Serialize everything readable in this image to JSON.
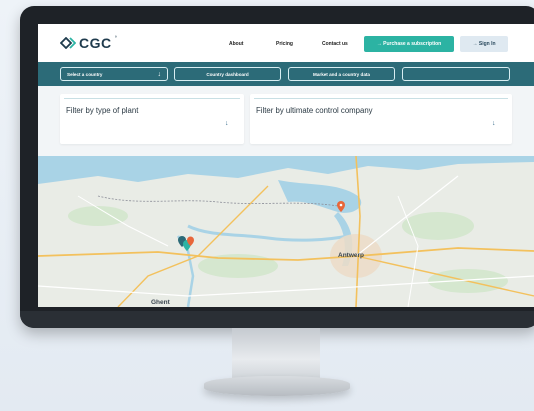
{
  "header": {
    "logo_text": "CGC",
    "logo_mark": "°",
    "nav": {
      "about": "About",
      "pricing": "Pricing",
      "contact": "Contact us"
    },
    "purchase_label": "→ Purchase a subscription",
    "signin_label": "→ Sign In"
  },
  "toolbar": {
    "select_country": "Select a country",
    "select_arrow": "↓",
    "country_dashboard": "Country dashboard",
    "market_data": "Market and a country data",
    "manufacturing": ""
  },
  "filters": {
    "plant": {
      "title": "Filter by type of plant",
      "placeholder": "",
      "arrow": "↓"
    },
    "company": {
      "title": "Filter by ultimate control company",
      "placeholder": "",
      "arrow": "↓"
    }
  },
  "map": {
    "labels": {
      "antwerp": "Antwerp",
      "ghent": "Ghent"
    },
    "colors": {
      "marker_orange": "#e8663a",
      "marker_teal": "#2cb3a3",
      "marker_dark": "#2c6b78"
    }
  }
}
